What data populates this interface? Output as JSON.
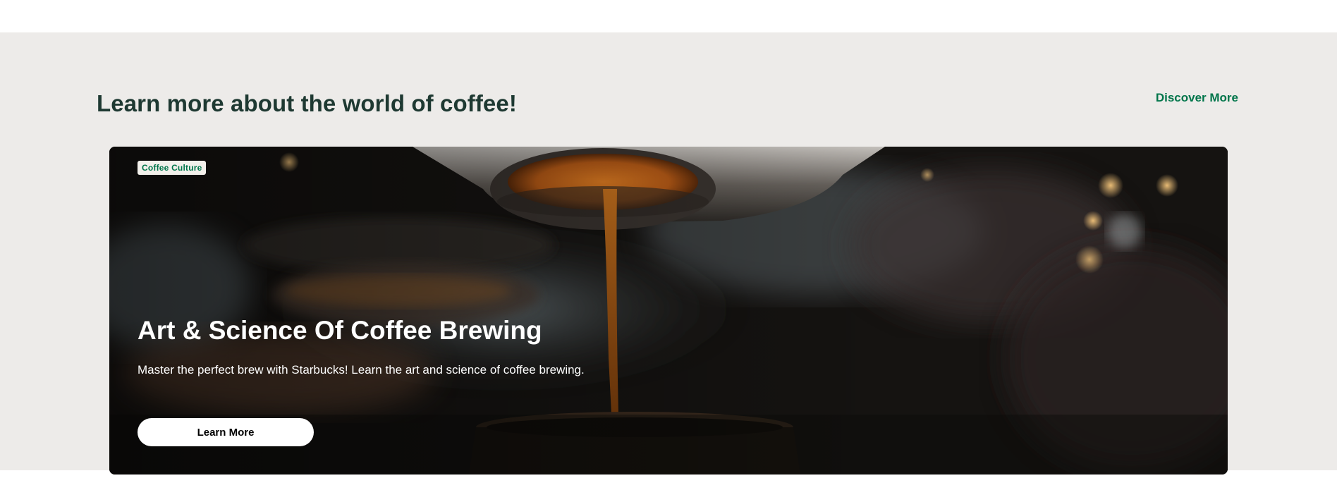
{
  "section": {
    "title": "Learn more about the world of coffee!",
    "discover_link": "Discover More",
    "background_color": "#edebe9",
    "title_color": "#1e3932",
    "accent_color": "#00754a"
  },
  "card": {
    "tag": "Coffee Culture",
    "heading": "Art & Science Of Coffee Brewing",
    "description": "Master the perfect brew with Starbucks! Learn the art and science of coffee brewing.",
    "button_label": "Learn More",
    "image_subject": "espresso-extraction-photo"
  }
}
